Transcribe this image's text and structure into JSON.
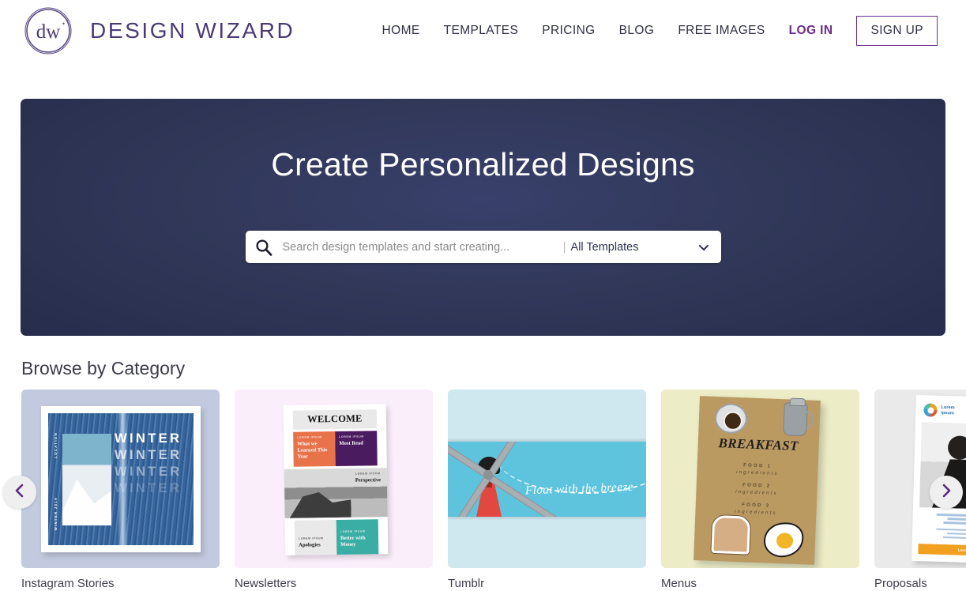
{
  "brand": {
    "logo_text": "dw",
    "name": "DESIGN WIZARD",
    "accent_color": "#4b3a75"
  },
  "nav": {
    "items": [
      {
        "label": "HOME"
      },
      {
        "label": "TEMPLATES"
      },
      {
        "label": "PRICING"
      },
      {
        "label": "BLOG"
      },
      {
        "label": "FREE IMAGES"
      },
      {
        "label": "LOG IN"
      }
    ],
    "signup_label": "SIGN UP",
    "login_color": "#6c2b8c"
  },
  "hero": {
    "title": "Create Personalized Designs",
    "background_color": "#2e3557",
    "search": {
      "placeholder": "Search design templates and start creating...",
      "value": "",
      "separator": "|",
      "filter_label": "All Templates"
    }
  },
  "categories": {
    "section_title": "Browse by Category",
    "prev_label": "‹",
    "next_label": "›",
    "items": [
      {
        "label": "Instagram Stories",
        "bg": "#c3c9de",
        "design": {
          "words": [
            "WINTER",
            "WINTER",
            "WINTER",
            "WINTER"
          ],
          "side_top": "LOCATION",
          "side_bottom": "WINTER 2019"
        }
      },
      {
        "label": "Newsletters",
        "bg": "#fbeefb",
        "design": {
          "welcome": "WELCOME",
          "lorem": "LOREM IPSUM",
          "block1": "What we Learned This Year",
          "block2": "Most Read",
          "block3": "Perspective",
          "block4": "Apologies",
          "block5": "Better with Money"
        }
      },
      {
        "label": "Tumblr",
        "bg": "#cfe7ef",
        "design": {
          "script": "Float with the breeze"
        }
      },
      {
        "label": "Menus",
        "bg": "#ecedc6",
        "design": {
          "title": "BREAKFAST",
          "items": [
            {
              "food": "FOOD 1",
              "ingredients": "ingredients"
            },
            {
              "food": "FOOD 2",
              "ingredients": "ingredients"
            },
            {
              "food": "FOOD 3",
              "ingredients": "ingredients"
            }
          ]
        }
      },
      {
        "label": "Proposals",
        "bg": "#eaeaea",
        "design": {
          "logo_line1": "Lorem",
          "logo_line2": "Ipsum",
          "cta": "Lorem ipsum"
        }
      }
    ]
  }
}
